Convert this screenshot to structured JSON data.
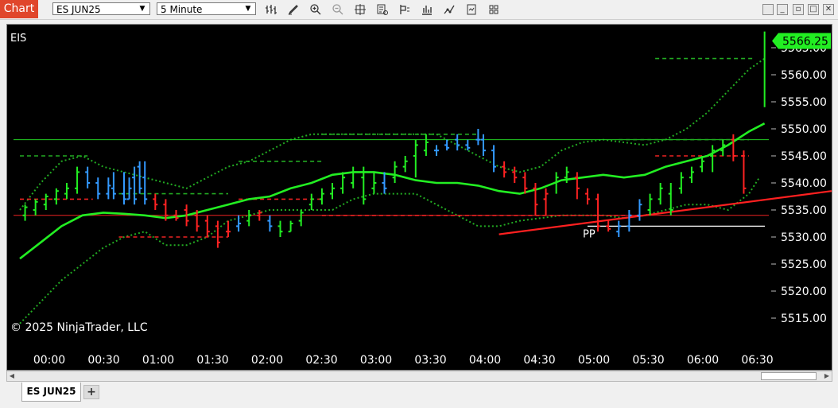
{
  "app": {
    "title": "Chart"
  },
  "toolbar": {
    "instrument": "ES JUN25",
    "interval": "5 Minute",
    "tools": [
      "bar-type-icon",
      "draw-pencil-icon",
      "zoom-in-icon",
      "zoom-out-icon",
      "crosshair-icon",
      "data-box-icon",
      "properties-icon",
      "indicators-icon",
      "strategies-icon",
      "templates-icon",
      "grid-icon"
    ]
  },
  "window_buttons": [
    "minimize",
    "restore",
    "maximize",
    "close"
  ],
  "chart": {
    "instrument_label": "EIS",
    "copyright": "© 2025 NinjaTrader, LLC",
    "last_price_label": "5566.25",
    "pp_label": "PP",
    "colors": {
      "up": "#22ee22",
      "down": "#ff2222",
      "neutral": "#3399ff",
      "ma": "#22ee22",
      "band": "#22aa22",
      "trend": "#ff2020",
      "pp": "#ffffff"
    }
  },
  "chart_data": {
    "type": "line",
    "y_ticks": [
      "5515.00",
      "5520.00",
      "5525.00",
      "5530.00",
      "5535.00",
      "5540.00",
      "5545.00",
      "5550.00",
      "5555.00",
      "5560.00",
      "5565.00"
    ],
    "x_ticks": [
      "00:00",
      "00:30",
      "01:00",
      "01:30",
      "02:00",
      "02:30",
      "03:00",
      "03:30",
      "04:00",
      "04:30",
      "05:00",
      "05:30",
      "06:00",
      "06:30"
    ],
    "ylim": [
      5512,
      5570
    ],
    "last_price": 5566.25,
    "pivot_pp": 5532,
    "horizontal_lines": [
      {
        "price": 5548,
        "color": "green"
      },
      {
        "price": 5534,
        "color": "red"
      }
    ],
    "moving_average": [
      [
        0,
        5526
      ],
      [
        4,
        5529
      ],
      [
        8,
        5532
      ],
      [
        12,
        5534
      ],
      [
        16,
        5534.5
      ],
      [
        20,
        5534.3
      ],
      [
        24,
        5534
      ],
      [
        28,
        5533.5
      ],
      [
        32,
        5534
      ],
      [
        36,
        5535
      ],
      [
        40,
        5536
      ],
      [
        44,
        5537
      ],
      [
        48,
        5537.5
      ],
      [
        52,
        5539
      ],
      [
        56,
        5540
      ],
      [
        60,
        5541.5
      ],
      [
        64,
        5542
      ],
      [
        68,
        5542
      ],
      [
        72,
        5541.5
      ],
      [
        76,
        5540.5
      ],
      [
        80,
        5540
      ],
      [
        84,
        5540
      ],
      [
        88,
        5539.5
      ],
      [
        92,
        5538.5
      ],
      [
        96,
        5538
      ],
      [
        100,
        5539
      ],
      [
        104,
        5540.5
      ],
      [
        108,
        5541
      ],
      [
        112,
        5541.5
      ],
      [
        116,
        5541
      ],
      [
        120,
        5541.5
      ],
      [
        124,
        5543
      ],
      [
        128,
        5544
      ],
      [
        132,
        5545
      ],
      [
        136,
        5547
      ],
      [
        140,
        5549.5
      ],
      [
        143,
        5551
      ]
    ],
    "upper_band": [
      [
        0,
        5535
      ],
      [
        4,
        5540
      ],
      [
        8,
        5544
      ],
      [
        12,
        5545
      ],
      [
        16,
        5543
      ],
      [
        20,
        5542
      ],
      [
        24,
        5541
      ],
      [
        28,
        5540
      ],
      [
        32,
        5539
      ],
      [
        36,
        5541
      ],
      [
        40,
        5543
      ],
      [
        44,
        5544
      ],
      [
        48,
        5546
      ],
      [
        52,
        5548
      ],
      [
        56,
        5549
      ],
      [
        60,
        5549
      ],
      [
        64,
        5549
      ],
      [
        68,
        5549
      ],
      [
        72,
        5549
      ],
      [
        76,
        5549
      ],
      [
        80,
        5549
      ],
      [
        84,
        5547
      ],
      [
        88,
        5545
      ],
      [
        92,
        5543
      ],
      [
        96,
        5542
      ],
      [
        100,
        5543
      ],
      [
        104,
        5546
      ],
      [
        108,
        5547.5
      ],
      [
        112,
        5548
      ],
      [
        116,
        5547.5
      ],
      [
        120,
        5547
      ],
      [
        124,
        5548
      ],
      [
        128,
        5550
      ],
      [
        132,
        5553
      ],
      [
        136,
        5557
      ],
      [
        140,
        5561
      ],
      [
        143,
        5563
      ]
    ],
    "lower_band": [
      [
        0,
        5514
      ],
      [
        4,
        5518
      ],
      [
        8,
        5522
      ],
      [
        12,
        5525
      ],
      [
        16,
        5528
      ],
      [
        20,
        5530
      ],
      [
        24,
        5531
      ],
      [
        28,
        5528.5
      ],
      [
        32,
        5528.5
      ],
      [
        36,
        5530
      ],
      [
        40,
        5533
      ],
      [
        44,
        5534
      ],
      [
        48,
        5535
      ],
      [
        52,
        5535
      ],
      [
        56,
        5535
      ],
      [
        60,
        5535
      ],
      [
        64,
        5537
      ],
      [
        68,
        5538
      ],
      [
        72,
        5538
      ],
      [
        76,
        5538
      ],
      [
        80,
        5536
      ],
      [
        84,
        5534
      ],
      [
        88,
        5532
      ],
      [
        92,
        5532
      ],
      [
        96,
        5533
      ],
      [
        100,
        5533.5
      ],
      [
        104,
        5534
      ],
      [
        108,
        5534
      ],
      [
        112,
        5534
      ],
      [
        116,
        5533.5
      ],
      [
        120,
        5534
      ],
      [
        124,
        5535
      ],
      [
        128,
        5536
      ],
      [
        132,
        5536
      ],
      [
        136,
        5535
      ],
      [
        140,
        5538
      ],
      [
        142,
        5541
      ]
    ],
    "trend_line": [
      [
        92,
        5530.5
      ],
      [
        144,
        5538.5
      ]
    ],
    "ohlc_bars": [
      {
        "i": 1,
        "o": 5534,
        "h": 5536,
        "l": 5533,
        "c": 5535.5,
        "dir": "up"
      },
      {
        "i": 3,
        "o": 5535,
        "h": 5537,
        "l": 5534,
        "c": 5536.5,
        "dir": "up"
      },
      {
        "i": 5,
        "o": 5536,
        "h": 5538,
        "l": 5535,
        "c": 5537.5,
        "dir": "up"
      },
      {
        "i": 7,
        "o": 5537,
        "h": 5539,
        "l": 5536,
        "c": 5538.5,
        "dir": "up"
      },
      {
        "i": 9,
        "o": 5538,
        "h": 5540,
        "l": 5537,
        "c": 5539,
        "dir": "up"
      },
      {
        "i": 11,
        "o": 5539,
        "h": 5543,
        "l": 5538,
        "c": 5542,
        "dir": "up"
      },
      {
        "i": 13,
        "o": 5542,
        "h": 5543,
        "l": 5539,
        "c": 5540,
        "dir": "neutral"
      },
      {
        "i": 15,
        "o": 5540,
        "h": 5541,
        "l": 5537,
        "c": 5538,
        "dir": "neutral"
      },
      {
        "i": 17,
        "o": 5538,
        "h": 5541,
        "l": 5537,
        "c": 5539.5,
        "dir": "neutral"
      },
      {
        "i": 18,
        "o": 5539,
        "h": 5542,
        "l": 5537,
        "c": 5538,
        "dir": "neutral"
      },
      {
        "i": 20,
        "o": 5538,
        "h": 5542,
        "l": 5536,
        "c": 5537,
        "dir": "neutral"
      },
      {
        "i": 21,
        "o": 5537,
        "h": 5541,
        "l": 5537,
        "c": 5539,
        "dir": "neutral"
      },
      {
        "i": 22,
        "o": 5541,
        "h": 5543,
        "l": 5536,
        "c": 5537,
        "dir": "neutral"
      },
      {
        "i": 23,
        "o": 5543,
        "h": 5544,
        "l": 5538,
        "c": 5539,
        "dir": "neutral"
      },
      {
        "i": 24,
        "o": 5541,
        "h": 5544,
        "l": 5536,
        "c": 5537,
        "dir": "neutral"
      },
      {
        "i": 26,
        "o": 5537,
        "h": 5538,
        "l": 5535,
        "c": 5536,
        "dir": "down"
      },
      {
        "i": 28,
        "o": 5536,
        "h": 5537,
        "l": 5533,
        "c": 5534,
        "dir": "down"
      },
      {
        "i": 30,
        "o": 5534,
        "h": 5535,
        "l": 5533,
        "c": 5533.5,
        "dir": "down"
      },
      {
        "i": 32,
        "o": 5535,
        "h": 5536,
        "l": 5532,
        "c": 5533,
        "dir": "down"
      },
      {
        "i": 34,
        "o": 5534,
        "h": 5535,
        "l": 5531,
        "c": 5532,
        "dir": "down"
      },
      {
        "i": 36,
        "o": 5533,
        "h": 5534,
        "l": 5530,
        "c": 5531,
        "dir": "down"
      },
      {
        "i": 38,
        "o": 5532,
        "h": 5533,
        "l": 5528,
        "c": 5529,
        "dir": "down"
      },
      {
        "i": 40,
        "o": 5531,
        "h": 5533,
        "l": 5530,
        "c": 5531,
        "dir": "down"
      },
      {
        "i": 42,
        "o": 5532,
        "h": 5534,
        "l": 5531,
        "c": 5532.5,
        "dir": "neutral"
      },
      {
        "i": 44,
        "o": 5533,
        "h": 5535,
        "l": 5532,
        "c": 5534,
        "dir": "up"
      },
      {
        "i": 46,
        "o": 5534,
        "h": 5535,
        "l": 5533,
        "c": 5534.5,
        "dir": "down"
      },
      {
        "i": 48,
        "o": 5533,
        "h": 5534,
        "l": 5531,
        "c": 5532,
        "dir": "neutral"
      },
      {
        "i": 50,
        "o": 5532,
        "h": 5533,
        "l": 5530,
        "c": 5531,
        "dir": "up"
      },
      {
        "i": 52,
        "o": 5531,
        "h": 5533,
        "l": 5531,
        "c": 5532.5,
        "dir": "up"
      },
      {
        "i": 54,
        "o": 5533,
        "h": 5535,
        "l": 5532,
        "c": 5534.5,
        "dir": "up"
      },
      {
        "i": 56,
        "o": 5536,
        "h": 5538,
        "l": 5535,
        "c": 5537,
        "dir": "up"
      },
      {
        "i": 58,
        "o": 5537,
        "h": 5539,
        "l": 5536,
        "c": 5538,
        "dir": "up"
      },
      {
        "i": 60,
        "o": 5538,
        "h": 5540,
        "l": 5537,
        "c": 5539,
        "dir": "up"
      },
      {
        "i": 62,
        "o": 5539,
        "h": 5542,
        "l": 5538,
        "c": 5541,
        "dir": "up"
      },
      {
        "i": 64,
        "o": 5540,
        "h": 5543,
        "l": 5539,
        "c": 5542,
        "dir": "up"
      },
      {
        "i": 66,
        "o": 5541,
        "h": 5543,
        "l": 5536,
        "c": 5537,
        "dir": "up"
      },
      {
        "i": 68,
        "o": 5539,
        "h": 5542,
        "l": 5538,
        "c": 5540,
        "dir": "up"
      },
      {
        "i": 70,
        "o": 5540,
        "h": 5542,
        "l": 5538,
        "c": 5539,
        "dir": "neutral"
      },
      {
        "i": 72,
        "o": 5541,
        "h": 5544,
        "l": 5540,
        "c": 5543,
        "dir": "up"
      },
      {
        "i": 74,
        "o": 5543,
        "h": 5545,
        "l": 5542,
        "c": 5544,
        "dir": "up"
      },
      {
        "i": 76,
        "o": 5545,
        "h": 5548,
        "l": 5541,
        "c": 5547,
        "dir": "up"
      },
      {
        "i": 78,
        "o": 5546,
        "h": 5549,
        "l": 5545,
        "c": 5547.5,
        "dir": "up"
      },
      {
        "i": 80,
        "o": 5546,
        "h": 5547,
        "l": 5545,
        "c": 5546,
        "dir": "neutral"
      },
      {
        "i": 82,
        "o": 5547,
        "h": 5548,
        "l": 5546,
        "c": 5546.5,
        "dir": "neutral"
      },
      {
        "i": 84,
        "o": 5548,
        "h": 5549,
        "l": 5546,
        "c": 5547,
        "dir": "neutral"
      },
      {
        "i": 86,
        "o": 5547,
        "h": 5548,
        "l": 5546,
        "c": 5546.5,
        "dir": "neutral"
      },
      {
        "i": 88,
        "o": 5548,
        "h": 5550,
        "l": 5547,
        "c": 5548,
        "dir": "neutral"
      },
      {
        "i": 89,
        "o": 5548,
        "h": 5549,
        "l": 5545,
        "c": 5546,
        "dir": "neutral"
      },
      {
        "i": 91,
        "o": 5546,
        "h": 5547,
        "l": 5542,
        "c": 5543,
        "dir": "neutral"
      },
      {
        "i": 93,
        "o": 5543,
        "h": 5544,
        "l": 5541,
        "c": 5542,
        "dir": "down"
      },
      {
        "i": 95,
        "o": 5542,
        "h": 5543,
        "l": 5540,
        "c": 5541,
        "dir": "down"
      },
      {
        "i": 97,
        "o": 5541,
        "h": 5542,
        "l": 5538,
        "c": 5539,
        "dir": "down"
      },
      {
        "i": 99,
        "o": 5539,
        "h": 5540,
        "l": 5534,
        "c": 5536,
        "dir": "down"
      },
      {
        "i": 101,
        "o": 5537,
        "h": 5539,
        "l": 5534,
        "c": 5538,
        "dir": "down"
      },
      {
        "i": 103,
        "o": 5540,
        "h": 5542,
        "l": 5538,
        "c": 5541,
        "dir": "up"
      },
      {
        "i": 105,
        "o": 5541,
        "h": 5543,
        "l": 5540,
        "c": 5542,
        "dir": "up"
      },
      {
        "i": 107,
        "o": 5541,
        "h": 5542,
        "l": 5537,
        "c": 5539,
        "dir": "down"
      },
      {
        "i": 109,
        "o": 5538,
        "h": 5539,
        "l": 5536,
        "c": 5537,
        "dir": "down"
      },
      {
        "i": 111,
        "o": 5537,
        "h": 5538,
        "l": 5531,
        "c": 5532,
        "dir": "down"
      },
      {
        "i": 113,
        "o": 5532,
        "h": 5533,
        "l": 5531,
        "c": 5531.5,
        "dir": "down"
      },
      {
        "i": 115,
        "o": 5531,
        "h": 5533,
        "l": 5530,
        "c": 5532,
        "dir": "neutral"
      },
      {
        "i": 117,
        "o": 5532,
        "h": 5535,
        "l": 5531,
        "c": 5534,
        "dir": "neutral"
      },
      {
        "i": 119,
        "o": 5534,
        "h": 5537,
        "l": 5533,
        "c": 5536,
        "dir": "neutral"
      },
      {
        "i": 121,
        "o": 5535,
        "h": 5538,
        "l": 5534,
        "c": 5537,
        "dir": "up"
      },
      {
        "i": 123,
        "o": 5537,
        "h": 5540,
        "l": 5536,
        "c": 5539,
        "dir": "up"
      },
      {
        "i": 125,
        "o": 5538,
        "h": 5540,
        "l": 5534,
        "c": 5535,
        "dir": "up"
      },
      {
        "i": 127,
        "o": 5539,
        "h": 5542,
        "l": 5538,
        "c": 5541,
        "dir": "up"
      },
      {
        "i": 129,
        "o": 5541,
        "h": 5543,
        "l": 5540,
        "c": 5542,
        "dir": "up"
      },
      {
        "i": 131,
        "o": 5543,
        "h": 5545,
        "l": 5542,
        "c": 5544,
        "dir": "up"
      },
      {
        "i": 133,
        "o": 5545,
        "h": 5547,
        "l": 5542,
        "c": 5546,
        "dir": "up"
      },
      {
        "i": 135,
        "o": 5546,
        "h": 5548,
        "l": 5545,
        "c": 5547,
        "dir": "up"
      },
      {
        "i": 137,
        "o": 5548,
        "h": 5549,
        "l": 5544,
        "c": 5545,
        "dir": "down"
      },
      {
        "i": 139,
        "o": 5545,
        "h": 5546,
        "l": 5538,
        "c": 5539,
        "dir": "down"
      }
    ]
  }
}
